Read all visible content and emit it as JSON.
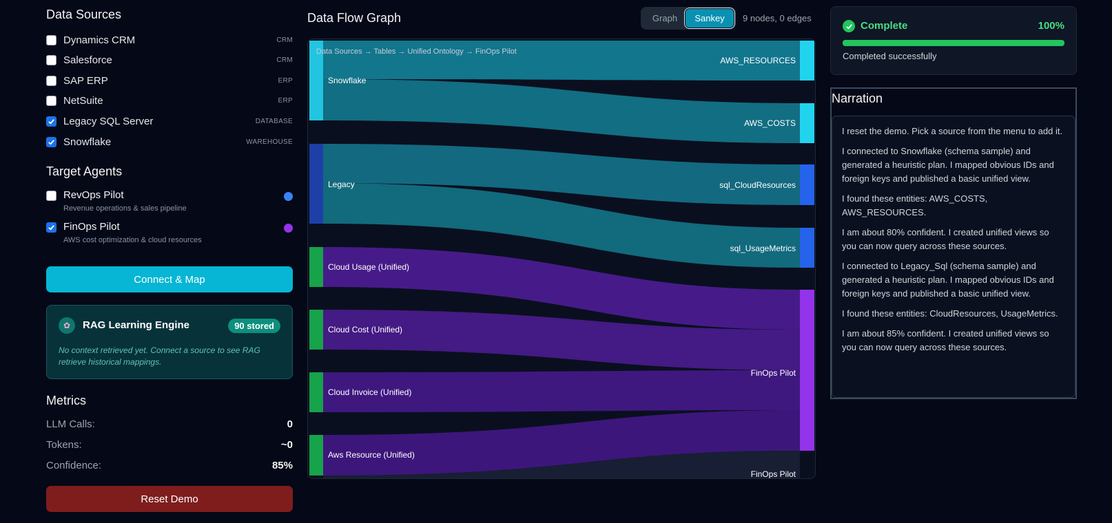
{
  "data_sources": {
    "title": "Data Sources",
    "items": [
      {
        "label": "Dynamics CRM",
        "tag": "CRM",
        "checked": false
      },
      {
        "label": "Salesforce",
        "tag": "CRM",
        "checked": false
      },
      {
        "label": "SAP ERP",
        "tag": "ERP",
        "checked": false
      },
      {
        "label": "NetSuite",
        "tag": "ERP",
        "checked": false
      },
      {
        "label": "Legacy SQL Server",
        "tag": "DATABASE",
        "checked": true
      },
      {
        "label": "Snowflake",
        "tag": "WAREHOUSE",
        "checked": true
      }
    ]
  },
  "target_agents": {
    "title": "Target Agents",
    "items": [
      {
        "name": "RevOps Pilot",
        "desc": "Revenue operations & sales pipeline",
        "checked": false,
        "color": "#3b82f6"
      },
      {
        "name": "FinOps Pilot",
        "desc": "AWS cost optimization & cloud resources",
        "checked": true,
        "color": "#9333ea"
      }
    ]
  },
  "connect_label": "Connect & Map",
  "rag": {
    "title": "RAG Learning Engine",
    "badge": "90 stored",
    "note": "No context retrieved yet. Connect a source to see RAG retrieve historical mappings.",
    "icon": "brain-icon"
  },
  "metrics": {
    "title": "Metrics",
    "rows": [
      {
        "label": "LLM Calls:",
        "value": "0"
      },
      {
        "label": "Tokens:",
        "value": "~0"
      },
      {
        "label": "Confidence:",
        "value": "85%"
      }
    ]
  },
  "reset_label": "Reset Demo",
  "graph": {
    "title": "Data Flow Graph",
    "toggle": {
      "graph": "Graph",
      "sankey": "Sankey",
      "active": "Sankey"
    },
    "node_count": "9 nodes, 0 edges",
    "caption": "Data Sources → Tables → Unified Ontology → FinOps Pilot",
    "left_nodes": [
      {
        "label": "Snowflake",
        "color": "#22d3ee"
      },
      {
        "label": "Legacy",
        "color": "#1e40af"
      },
      {
        "label": "Cloud Usage (Unified)",
        "color": "#16a34a"
      },
      {
        "label": "Cloud Cost (Unified)",
        "color": "#16a34a"
      },
      {
        "label": "Cloud Invoice (Unified)",
        "color": "#16a34a"
      },
      {
        "label": "Aws Resource (Unified)",
        "color": "#16a34a"
      }
    ],
    "right_nodes": [
      {
        "label": "AWS_RESOURCES",
        "color": "#22d3ee"
      },
      {
        "label": "AWS_COSTS",
        "color": "#22d3ee"
      },
      {
        "label": "sql_CloudResources",
        "color": "#2563eb"
      },
      {
        "label": "sql_UsageMetrics",
        "color": "#2563eb"
      },
      {
        "label": "FinOps Pilot",
        "color": "#9333ea"
      }
    ],
    "extra_label": "FinOps Pilot"
  },
  "status": {
    "title": "Complete",
    "percent": "100%",
    "progress": 1.0,
    "message": "Completed successfully",
    "icon": "check-circle-icon"
  },
  "narration": {
    "title": "Narration",
    "paragraphs": [
      "I reset the demo. Pick a source from the menu to add it.",
      "I connected to Snowflake (schema sample) and generated a heuristic plan. I mapped obvious IDs and foreign keys and published a basic unified view.",
      "I found these entities: AWS_COSTS, AWS_RESOURCES.",
      "I am about 80% confident. I created unified views so you can now query across these sources.",
      "I connected to Legacy_Sql (schema sample) and generated a heuristic plan. I mapped obvious IDs and foreign keys and published a basic unified view.",
      "I found these entities: CloudResources, UsageMetrics.",
      "I am about 85% confident. I created unified views so you can now query across these sources."
    ]
  }
}
